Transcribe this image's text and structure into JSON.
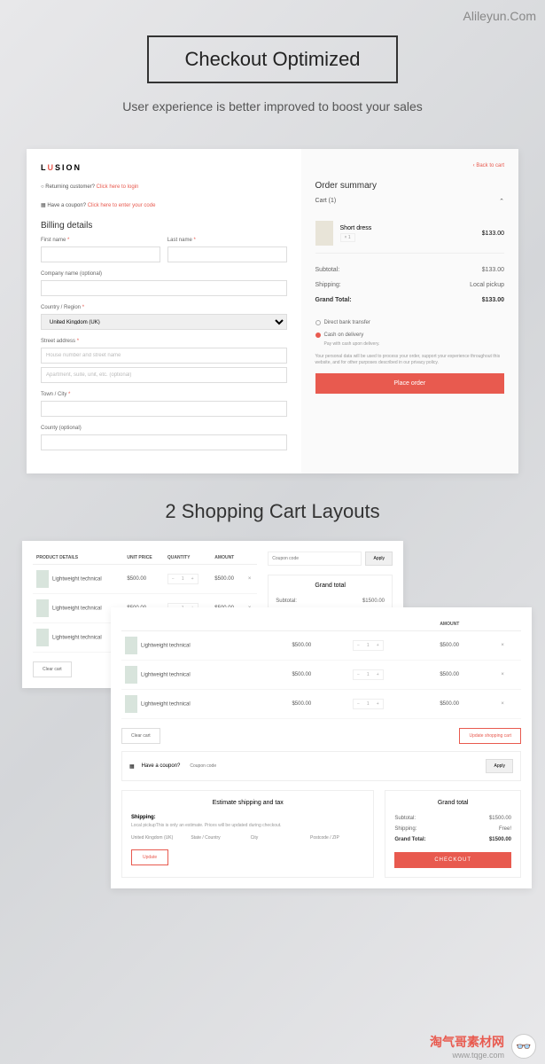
{
  "watermarks": {
    "top": "Alileyun.Com",
    "brand_zh": "淘气哥素材网",
    "brand_url": "www.tqge.com"
  },
  "hero": {
    "title": "Checkout Optimized",
    "subtitle": "User experience is better improved to boost your sales"
  },
  "checkout": {
    "logo1": "L",
    "logo2": "U",
    "logo3": "SION",
    "returning": "Returning customer? ",
    "returning_link": "Click here to login",
    "coupon": "Have a coupon? ",
    "coupon_link": "Click here to enter your code",
    "billing_h": "Billing details",
    "fields": {
      "first_name": "First name",
      "last_name": "Last name",
      "company": "Company name (optional)",
      "country": "Country / Region",
      "country_val": "United Kingdom (UK)",
      "street": "Street address",
      "street_ph1": "House number and street name ",
      "street_ph2": "Apartment, suite, unit, etc. (optional)",
      "town": "Town / City",
      "county": "County (optional)"
    },
    "summary": {
      "back": "‹ Back to cart",
      "title": "Order summary",
      "cart_label": "Cart (1)",
      "item_name": "Short dress",
      "item_qty": "× 1",
      "item_price": "$133.00",
      "subtotal_l": "Subtotal:",
      "subtotal_v": "$133.00",
      "shipping_l": "Shipping:",
      "shipping_v": "Local pickup",
      "grand_l": "Grand Total:",
      "grand_v": "$133.00",
      "pay1": "Direct bank transfer",
      "pay2": "Cash on delivery",
      "pay2_note": "Pay with cash upon delivery.",
      "privacy": "Your personal data will be used to process your order, support your experience throughout this website, and for other purposes described in our privacy policy.",
      "place_order": "Place order"
    }
  },
  "section2_title": "2 Shopping Cart Layouts",
  "cart_table": {
    "h1": "PRODUCT DETAILS",
    "h2": "UNIT PRICE",
    "h3": "QUANTITY",
    "h4": "AMOUNT",
    "product": "Lightweight technical",
    "price": "$500.00",
    "qty": "1",
    "amount": "$500.00",
    "clear": "Clear cart",
    "update": "Update shopping cart"
  },
  "cart_side": {
    "coupon_ph": "Coupon code",
    "apply": "Apply",
    "gt_title": "Grand total",
    "subtotal_l": "Subtotal:",
    "subtotal_v": "$1500.00",
    "shipping_l": "Shipping:",
    "shipping_v": "Free!",
    "grand_l": "Grand Total:",
    "grand_v": "$1500.00",
    "checkout": "CHECKOUT"
  },
  "cart_b": {
    "coupon_label": "Have a coupon?",
    "est_title": "Estimate shipping and tax",
    "ship_l": "Shipping:",
    "ship_note": "Local pickupThis is only an estimate. Prices will be updated during checkout.",
    "f1": "United Kingdom (UK)",
    "f2": "State / Country",
    "f3": "City",
    "f4": "Postcode / ZIP",
    "update": "Update"
  }
}
